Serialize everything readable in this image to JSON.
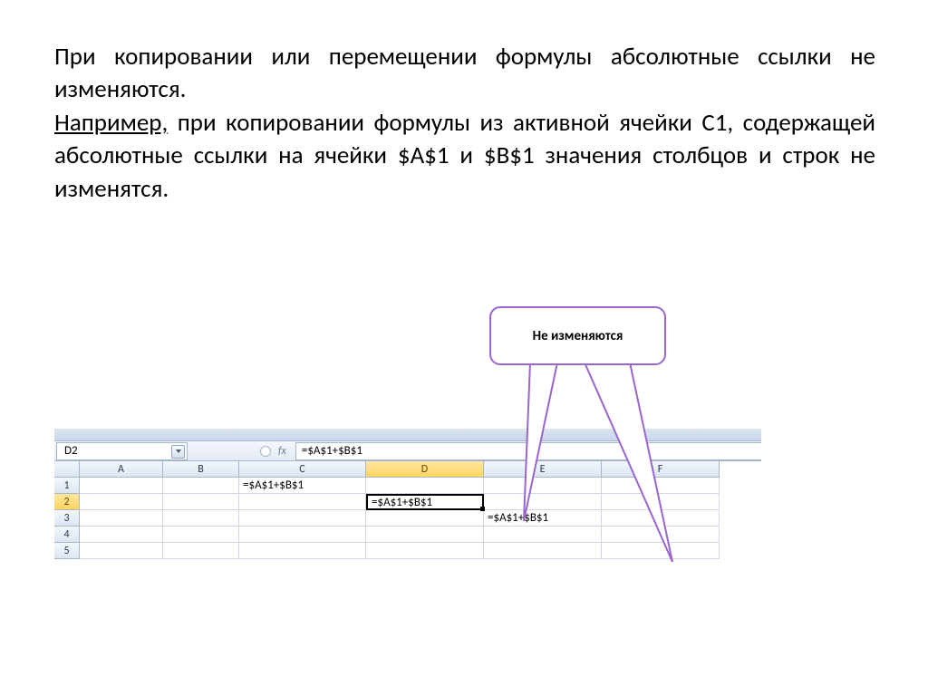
{
  "text": {
    "para1": "При копировании или перемещении формулы абсолютные ссылки не  изменяются.",
    "para2_intro": "Например,",
    "para2_rest": " при  копировании формулы из активной ячейки С1, содержащей абсолютные ссылки на ячейки $A$1  и $B$1 значения столбцов и строк не изменятся."
  },
  "callout": {
    "label": "Не изменяются"
  },
  "excel": {
    "name_box": "D2",
    "fx": "fx",
    "formula": "=$A$1+$B$1",
    "formula_partial": "=$A$1+$   1",
    "cols": [
      "A",
      "B",
      "C",
      "D",
      "E",
      "F"
    ],
    "rows": [
      "1",
      "2",
      "3",
      "4",
      "5"
    ],
    "cells": {
      "C1": "=$A$1+$B$1",
      "D2": "=$A$1+$B$1",
      "E3": "=$A$1+$B$1"
    }
  }
}
